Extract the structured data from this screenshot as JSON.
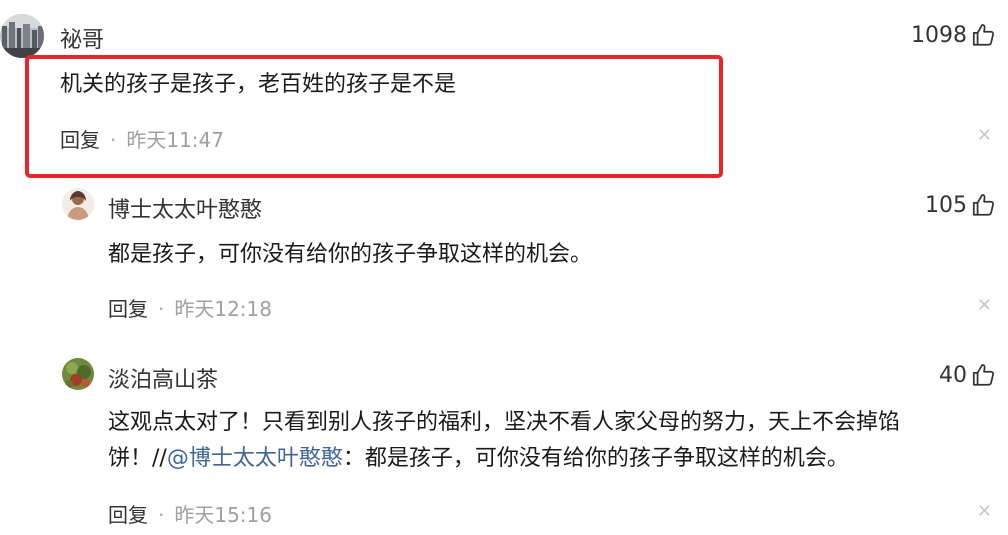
{
  "comments": [
    {
      "username": "祕哥",
      "likes": "1098",
      "content": "机关的孩子是孩子，老百姓的孩子是不是",
      "reply_label": "回复",
      "separator": "·",
      "time": "昨天11:47",
      "highlight_color": "#e8262b"
    },
    {
      "username": "博士太太叶憨憨",
      "likes": "105",
      "content": "都是孩子，可你没有给你的孩子争取这样的机会。",
      "reply_label": "回复",
      "separator": "·",
      "time": "昨天12:18"
    },
    {
      "username": "淡泊高山茶",
      "likes": "40",
      "content_line1": "这观点太对了！只看到别人孩子的福利，坚决不看人家父母的努力，天上不会掉馅",
      "content_prefix": "饼！//",
      "mention": "@博士太太叶憨憨",
      "content_suffix": "：都是孩子，可你没有给你的孩子争取这样的机会。",
      "reply_label": "回复",
      "separator": "·",
      "time": "昨天15:16"
    }
  ],
  "icons": {
    "like": "thumbs-up-icon",
    "close": "close-icon",
    "close_glyph": "✕"
  },
  "colors": {
    "mention": "#406599",
    "time": "#a0a0a0",
    "highlight": "#e8262b"
  }
}
